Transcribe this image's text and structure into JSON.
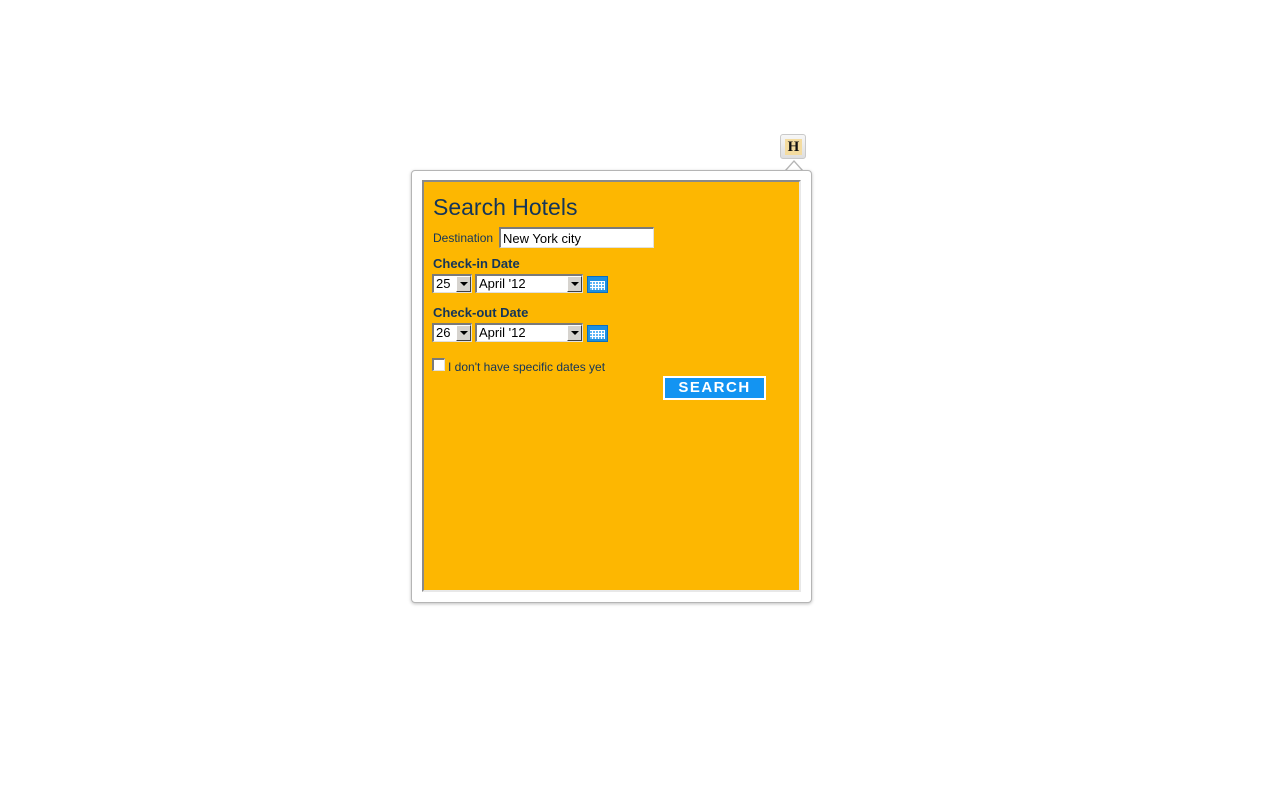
{
  "extension": {
    "icon_letter": "H"
  },
  "widget": {
    "title": "Search Hotels",
    "destination": {
      "label": "Destination",
      "value": "New York city"
    },
    "checkin": {
      "label": "Check-in Date",
      "day": "25",
      "month": "April '12"
    },
    "checkout": {
      "label": "Check-out Date",
      "day": "26",
      "month": "April '12"
    },
    "no_dates": {
      "label": "I don't have specific dates yet",
      "checked": false
    },
    "search_label": "SEARCH"
  },
  "colors": {
    "widget_bg": "#fdb701",
    "text": "#13355a",
    "button_bg": "#1394f2"
  }
}
